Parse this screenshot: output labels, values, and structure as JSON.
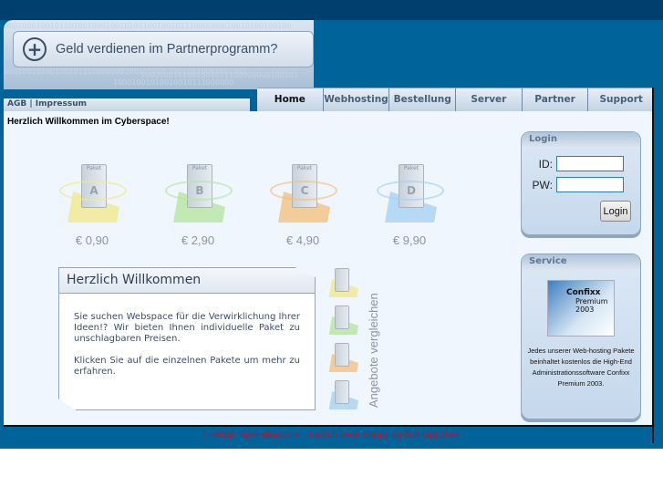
{
  "banner": {
    "promo": "Geld verdienen im Partnerprogramm?",
    "bits1": "00010001001010010010001001010010010010111000000010010100100100",
    "bits2": "1000100101001001011100000000100101",
    "bits3": "00010010100100101110000000100101010     10010010001001001",
    "bits4": "10001001010010010111000000"
  },
  "subnav": {
    "agb": "AGB",
    "sep": "|",
    "impressum": "Impressum"
  },
  "nav": [
    "Home",
    "Webhosting",
    "Bestellung",
    "Server",
    "Partner",
    "Support"
  ],
  "content": {
    "headline": "Herzlich Willkommen im Cyberspace!"
  },
  "packages": [
    {
      "letter": "A",
      "label": "Paket",
      "price": "€ 0,90",
      "color": "#f0ea8c"
    },
    {
      "letter": "B",
      "label": "Paket",
      "price": "€ 2,90",
      "color": "#b7e6a0"
    },
    {
      "letter": "C",
      "label": "Paket",
      "price": "€ 4,90",
      "color": "#f2c27f"
    },
    {
      "letter": "D",
      "label": "Paket",
      "price": "€ 9,90",
      "color": "#a7d2f4"
    }
  ],
  "welcome": {
    "title": "Herzlich Willkommen",
    "p1": "Sie suchen Webspace für die Verwirklichung Ihrer Ideen!? Wir bieten Ihnen individuelle Paket zu unschlagbaren Preisen.",
    "p2": "Klicken Sie auf die einzelnen Pakete um mehr zu erfahren."
  },
  "compare": "Angebote vergleichen",
  "login": {
    "title": "Login",
    "id_label": "ID:",
    "pw_label": "PW:",
    "button": "Login"
  },
  "service": {
    "title": "Service",
    "product": "Confixx",
    "product_sub": "Premium 2003",
    "text": "Jedes unserer Web-hosting Pakete beinhaltet kostenlos die High-End Administrationssoftware Confixx Premium 2003."
  },
  "footer": {
    "text": "Linktipp: Spar-Blog.com - Täglich neue Shopping-Schnäppchen"
  }
}
